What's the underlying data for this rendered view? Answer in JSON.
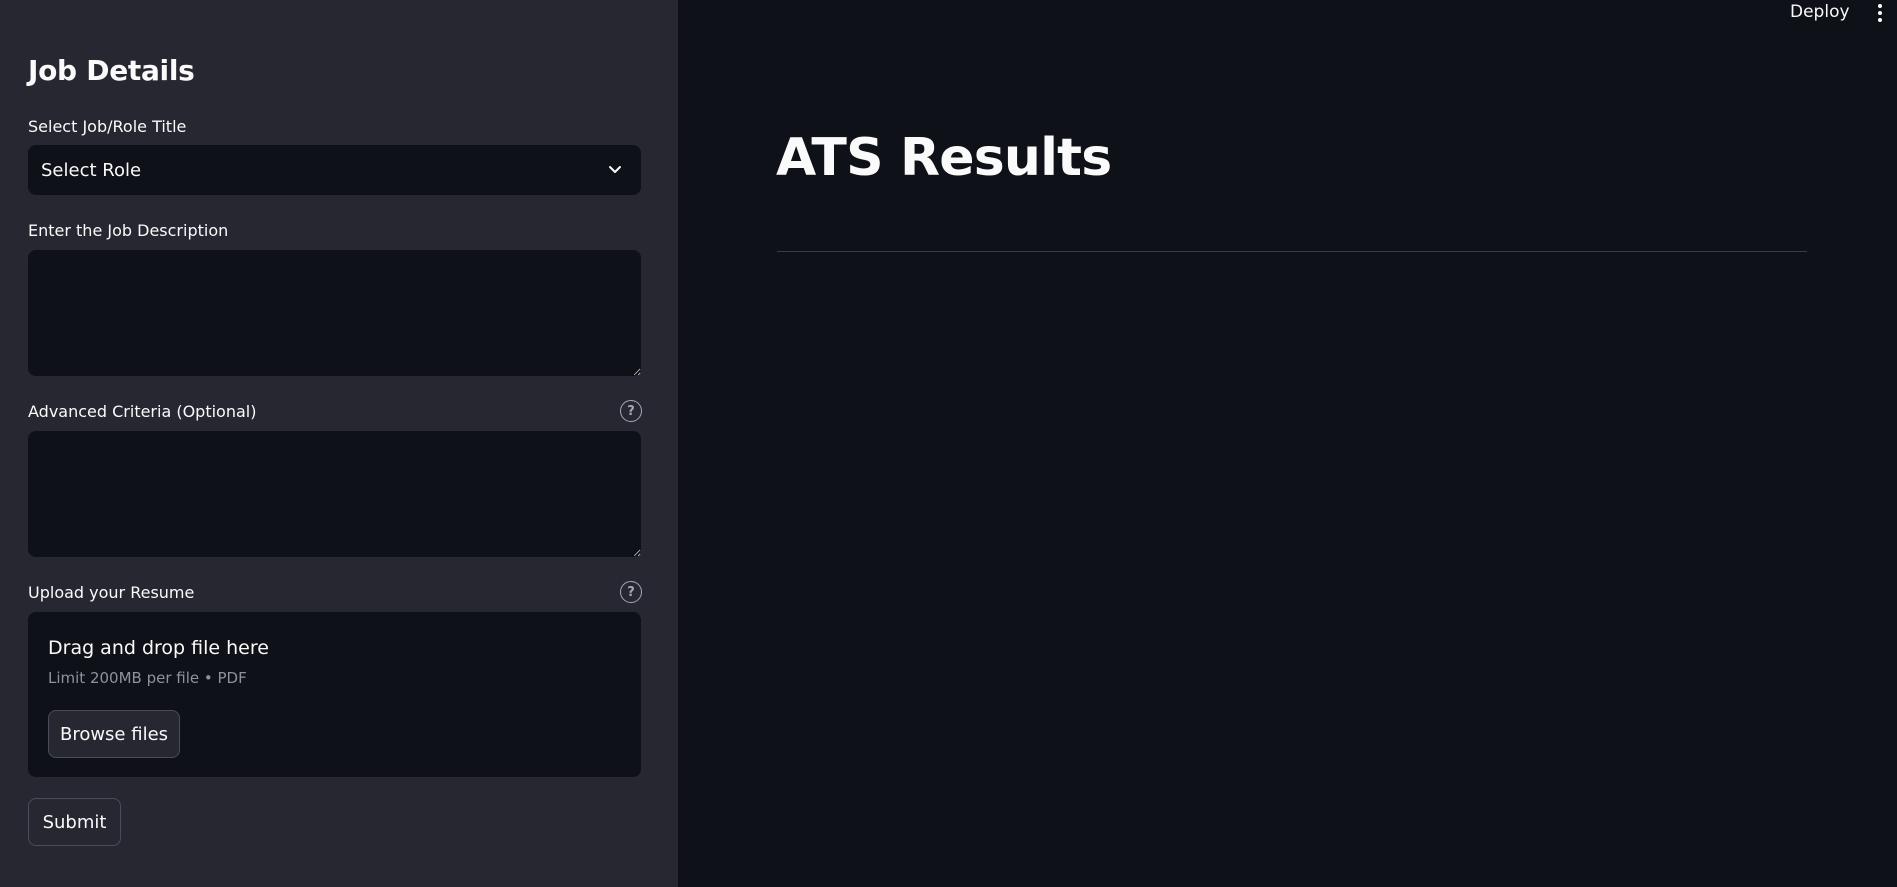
{
  "sidebar": {
    "title": "Job Details",
    "role_label": "Select Job/Role Title",
    "role_value": "Select Role",
    "description_label": "Enter the Job Description",
    "description_value": "",
    "criteria_label": "Advanced Criteria (Optional)",
    "criteria_value": "",
    "upload_label": "Upload your Resume",
    "upload": {
      "title": "Drag and drop file here",
      "subtitle": "Limit 200MB per file • PDF",
      "browse_label": "Browse files"
    },
    "submit_label": "Submit",
    "help_glyph": "?"
  },
  "main": {
    "title": "ATS Results"
  },
  "toolbar": {
    "deploy_label": "Deploy"
  },
  "icons": {
    "select": "chevron-down-icon",
    "help": "help-circle-icon",
    "menu": "more-vertical-icon"
  },
  "colors": {
    "background": "#0e1117",
    "sidebar": "#262730",
    "text": "#fafafa",
    "muted": "#8e929c"
  }
}
